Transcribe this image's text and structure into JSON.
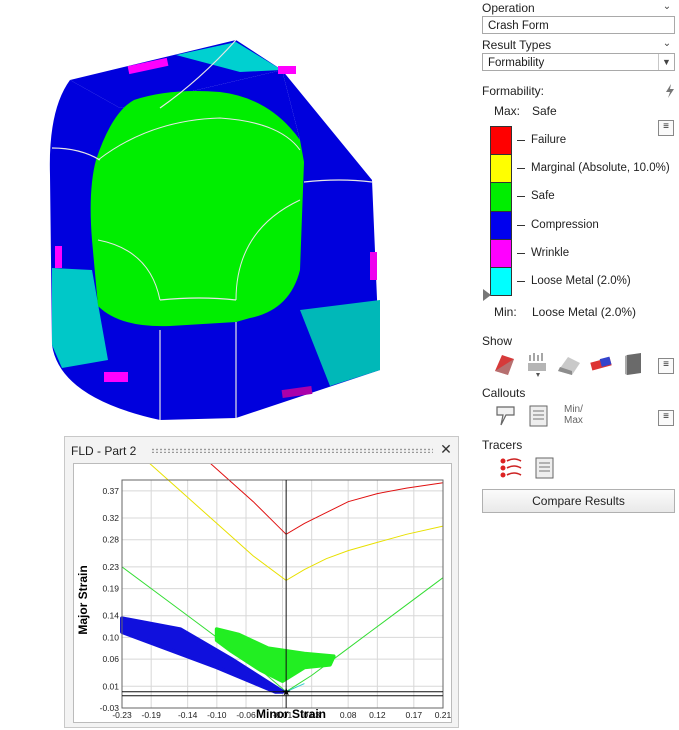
{
  "side": {
    "operation_label": "Operation",
    "operation_value": "Crash Form",
    "result_types_label": "Result Types",
    "result_types_value": "Formability",
    "formability_label": "Formability:",
    "max_label": "Max:",
    "max_value": "Safe",
    "min_label": "Min:",
    "min_value": "Loose Metal (2.0%)",
    "legend": [
      {
        "label": "Failure",
        "color": "#ff0000"
      },
      {
        "label": "Marginal (Absolute, 10.0%)",
        "color": "#ffff00"
      },
      {
        "label": "Safe",
        "color": "#00ee00"
      },
      {
        "label": "Compression",
        "color": "#0000ee"
      },
      {
        "label": "Wrinkle",
        "color": "#ff00ff"
      },
      {
        "label": "Loose Metal (2.0%)",
        "color": "#00ffff"
      }
    ],
    "show_label": "Show",
    "callouts_label": "Callouts",
    "minmax_label_1": "Min/",
    "minmax_label_2": "Max",
    "tracers_label": "Tracers",
    "compare_button": "Compare Results"
  },
  "fld": {
    "title": "FLD - Part 2"
  },
  "chart_data": {
    "type": "scatter",
    "title": "",
    "xlabel": "Minor Strain",
    "ylabel": "Major Strain",
    "xlim": [
      -0.23,
      0.21
    ],
    "ylim": [
      -0.03,
      0.39
    ],
    "x_ticks": [
      "-0.23",
      "-0.19",
      "-0.14",
      "-0.10",
      "-0.06",
      "-0.01",
      "0.03",
      "0.08",
      "0.12",
      "0.17",
      "0.21"
    ],
    "x_tick_values": [
      -0.23,
      -0.19,
      -0.14,
      -0.1,
      -0.06,
      -0.01,
      0.03,
      0.08,
      0.12,
      0.17,
      0.21
    ],
    "y_ticks": [
      "0.37",
      "0.32",
      "0.28",
      "0.23",
      "0.19",
      "0.14",
      "0.10",
      "0.06",
      "0.01",
      "-0.03"
    ],
    "y_tick_values": [
      0.37,
      0.32,
      0.28,
      0.23,
      0.19,
      0.14,
      0.1,
      0.06,
      0.01,
      -0.03
    ],
    "grid": true,
    "curves": [
      {
        "role": "failure",
        "color": "#e01010",
        "x": [
          -0.23,
          -0.2,
          -0.15,
          -0.1,
          -0.05,
          -0.005,
          0.02,
          0.05,
          0.08,
          0.12,
          0.16,
          0.21
        ],
        "y": [
          0.57,
          0.53,
          0.47,
          0.41,
          0.35,
          0.29,
          0.31,
          0.33,
          0.35,
          0.365,
          0.375,
          0.385
        ]
      },
      {
        "role": "marginal",
        "color": "#e8e000",
        "x": [
          -0.23,
          -0.2,
          -0.15,
          -0.1,
          -0.05,
          -0.005,
          0.02,
          0.05,
          0.08,
          0.12,
          0.16,
          0.21
        ],
        "y": [
          0.47,
          0.43,
          0.37,
          0.31,
          0.25,
          0.205,
          0.225,
          0.245,
          0.26,
          0.275,
          0.29,
          0.305
        ]
      },
      {
        "role": "safe",
        "color": "#33dd33",
        "x": [
          -0.23,
          -0.18,
          -0.13,
          -0.08,
          -0.04,
          -0.005,
          0.03,
          0.07,
          0.11,
          0.15,
          0.21
        ],
        "y": [
          0.23,
          0.18,
          0.13,
          0.08,
          0.04,
          0.0,
          0.03,
          0.07,
          0.11,
          0.15,
          0.21
        ]
      },
      {
        "role": "wrinkle",
        "color": "#ff00ff",
        "x": [
          -0.23,
          -0.15,
          -0.08,
          -0.005
        ],
        "y": [
          0.125,
          0.085,
          0.045,
          0.0
        ]
      },
      {
        "role": "loose",
        "color": "#33cccc",
        "x": [
          -0.03,
          -0.005,
          0.02
        ],
        "y": [
          0.015,
          0.0,
          0.015
        ]
      }
    ],
    "clusters": [
      {
        "role": "compression",
        "color": "#1010dd",
        "region": [
          [
            -0.23,
            0.135
          ],
          [
            -0.15,
            0.115
          ],
          [
            -0.08,
            0.06
          ],
          [
            -0.01,
            0.0
          ],
          [
            -0.02,
            0.0
          ],
          [
            -0.1,
            0.045
          ],
          [
            -0.23,
            0.11
          ]
        ]
      },
      {
        "role": "safe",
        "color": "#22ee22",
        "region": [
          [
            -0.1,
            0.115
          ],
          [
            -0.07,
            0.105
          ],
          [
            -0.03,
            0.08
          ],
          [
            0.02,
            0.07
          ],
          [
            0.06,
            0.065
          ],
          [
            0.055,
            0.05
          ],
          [
            0.02,
            0.045
          ],
          [
            -0.01,
            0.02
          ],
          [
            -0.04,
            0.04
          ],
          [
            -0.08,
            0.075
          ],
          [
            -0.1,
            0.095
          ]
        ]
      }
    ],
    "marker": {
      "x": -0.005,
      "y": 0.0
    }
  }
}
